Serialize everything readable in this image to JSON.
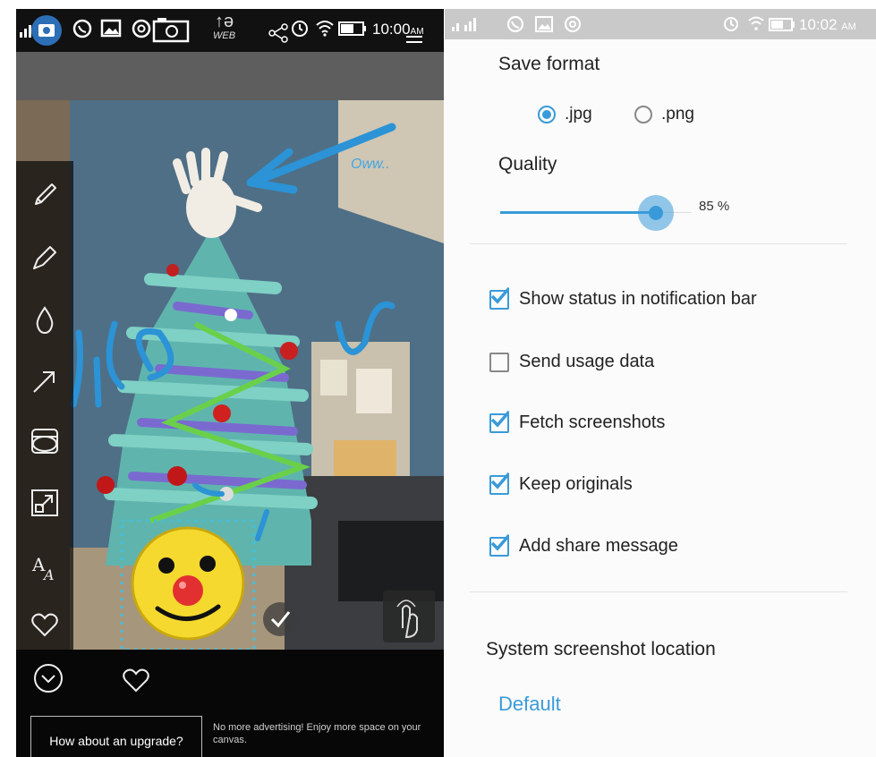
{
  "left": {
    "status": {
      "time": "10:00",
      "ampm": "AM",
      "web_label": "WEB"
    },
    "tools": [
      "pencil-icon",
      "marker-icon",
      "blur-drop-icon",
      "arrow-icon",
      "stamp-icon",
      "resize-icon",
      "text-size-icon",
      "heart-icon"
    ],
    "annotation_text": "Oww..",
    "upgrade_button": "How about an upgrade?",
    "ad_text": "No more advertising! Enjoy more space on your canvas."
  },
  "right": {
    "status": {
      "time": "10:02",
      "ampm": "AM"
    },
    "save_format": {
      "label": "Save format",
      "options": [
        {
          "label": ".jpg",
          "selected": true
        },
        {
          "label": ".png",
          "selected": false
        }
      ]
    },
    "quality": {
      "label": "Quality",
      "value": 85,
      "display": "85 %"
    },
    "checkboxes": [
      {
        "label": "Show status in notification bar",
        "checked": true
      },
      {
        "label": "Send usage data",
        "checked": false
      },
      {
        "label": "Fetch screenshots",
        "checked": true
      },
      {
        "label": "Keep originals",
        "checked": true
      },
      {
        "label": "Add share message",
        "checked": true
      }
    ],
    "location": {
      "label": "System screenshot location",
      "value": "Default"
    }
  },
  "colors": {
    "accent": "#3a9ad9",
    "check": "#3a9ad9"
  }
}
